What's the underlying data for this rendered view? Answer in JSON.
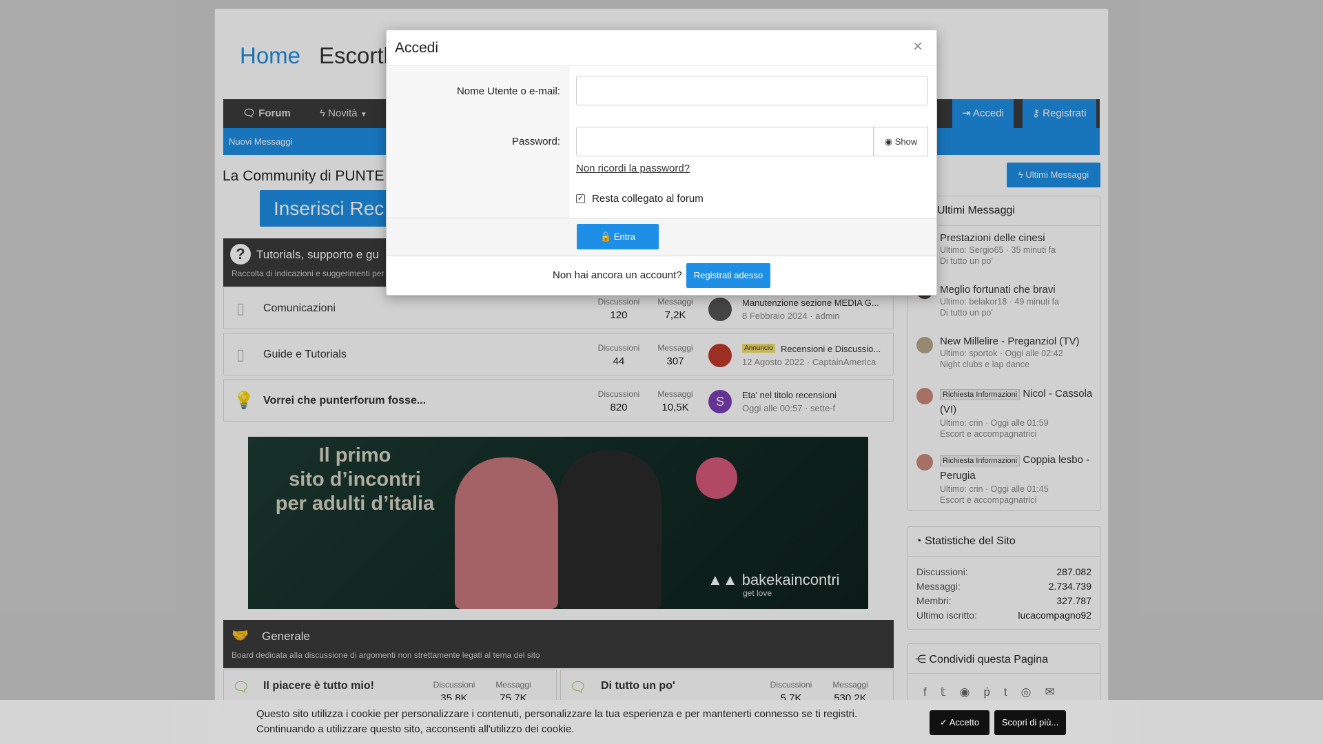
{
  "header": {
    "home": "Home",
    "title_partial": "Escorth"
  },
  "nav": {
    "forum": "Forum",
    "novita": "Novità",
    "accedi": "Accedi",
    "registrati": "Registrati",
    "nuovi_messaggi": "Nuovi Messaggi"
  },
  "main": {
    "community_title": "La Community di PUNTE",
    "insert_btn": "Inserisci Rec",
    "ultimi_btn": "Ultimi Messaggi"
  },
  "tutorials": {
    "title": "Tutorials, supporto e gu",
    "desc": "Raccolta di indicazioni e suggerimenti per"
  },
  "forums": [
    {
      "name": "Comunicazioni",
      "disc_label": "Discussioni",
      "disc": "120",
      "msg_label": "Messaggi",
      "msg": "7,2K",
      "last_title": "Manutenzione sezione MEDIA G...",
      "last_meta": "8 Febbraio 2024 · admin"
    },
    {
      "name": "Guide e Tutorials",
      "disc_label": "Discussioni",
      "disc": "44",
      "msg_label": "Messaggi",
      "msg": "307",
      "badge": "Annuncio",
      "last_title": "Recensioni e Discussio...",
      "last_meta": "12 Agosto 2022 · CaptainAmerica"
    },
    {
      "name": "Vorrei che punterforum fosse...",
      "disc_label": "Discussioni",
      "disc": "820",
      "msg_label": "Messaggi",
      "msg": "10,5K",
      "avatar_letter": "S",
      "last_title": "Eta' nel titolo recensioni",
      "last_meta": "Oggi alle 00:57 · sette-f"
    }
  ],
  "banner": {
    "line1": "Il primo",
    "line2": "sito d’incontri",
    "line3": "per adulti d’italia",
    "brand": "bakekaincontri",
    "tagline": "get love"
  },
  "generale": {
    "title": "Generale",
    "desc": "Board dedicata alla discussione di argomenti non strettamente legati al tema del sito",
    "f1": {
      "name": "Il piacere è tutto mio!",
      "disc_label": "Discussioni",
      "disc": "35,8K",
      "msg_label": "Messaggi",
      "msg": "75,7K"
    },
    "f2": {
      "name": "Di tutto un po'",
      "disc_label": "Discussioni",
      "disc": "5,7K",
      "msg_label": "Messaggi",
      "msg": "530,2K"
    }
  },
  "sidebar": {
    "ultimi_title": "Ultimi Messaggi",
    "posts": [
      {
        "title": "Prestazioni delle cinesi",
        "meta": "Ultimo: Sergio65 · 35 minuti fa",
        "forum": "Di tutto un po'"
      },
      {
        "title": "Meglio fortunati che bravi",
        "meta": "Ultimo: belakor18 · 49 minuti fa",
        "forum": "Di tutto un po'"
      },
      {
        "title": "New Millelire - Preganziol (TV)",
        "meta": "Ultimo: sportok · Oggi alle 02:42",
        "forum": "Night clubs e lap dance"
      },
      {
        "badge": "Richiesta Informazioni",
        "title": "Nicol - Cassola (VI)",
        "meta": "Ultimo: crin · Oggi alle 01:59",
        "forum": "Escort e accompagnatrici"
      },
      {
        "badge": "Richiesta Informazioni",
        "title": "Coppia lesbo - Perugia",
        "meta": "Ultimo: crin · Oggi alle 01:45",
        "forum": "Escort e accompagnatrici"
      }
    ],
    "stats_title": "Statistiche del Sito",
    "stats": [
      {
        "label": "Discussioni:",
        "value": "287.082"
      },
      {
        "label": "Messaggi:",
        "value": "2.734.739"
      },
      {
        "label": "Membri:",
        "value": "327.787"
      },
      {
        "label": "Ultimo iscritto:",
        "value": "lucacompagno92"
      }
    ],
    "share_title": "Condividi questa Pagina"
  },
  "modal": {
    "title": "Accedi",
    "user_label": "Nome Utente o e-mail:",
    "password_label": "Password:",
    "show": "Show",
    "forgot": "Non ricordi la password?",
    "remember": "Resta collegato al forum",
    "submit": "Entra",
    "no_account": "Non hai ancora un account?",
    "register_now": "Registrati adesso"
  },
  "cookie": {
    "line1": "Questo sito utilizza i cookie per personalizzare i contenuti, personalizzare la tua esperienza e per mantenerti connesso se ti registri.",
    "line2": "Continuando a utilizzare questo sito, acconsenti all'utilizzo dei cookie.",
    "accept": "Accetto",
    "more": "Scopri di più..."
  },
  "colors": {
    "accent": "#1e8fe6",
    "dark": "#3b3b3b",
    "purple": "#7a3fb5"
  }
}
